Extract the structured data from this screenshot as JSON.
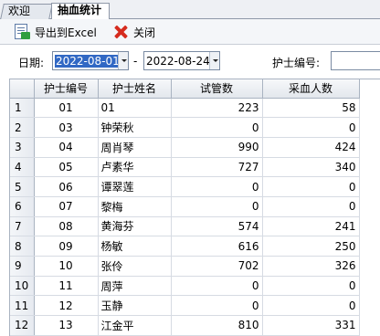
{
  "tabs": [
    {
      "label": "欢迎"
    },
    {
      "label": "抽血统计"
    }
  ],
  "toolbar": {
    "export_label": "导出到Excel",
    "close_label": "关闭"
  },
  "filter": {
    "date_label": "日期:",
    "start_date": "2022-08-01",
    "dash": "-",
    "end_date": "2022-08-24",
    "nurse_id_label": "护士编号:",
    "nurse_id_value": ""
  },
  "grid": {
    "columns": [
      "",
      "护士编号",
      "护士姓名",
      "试管数",
      "采血人数"
    ],
    "rows": [
      {
        "n": "1",
        "id": "01",
        "name": "01",
        "tubes": "223",
        "people": "58"
      },
      {
        "n": "2",
        "id": "03",
        "name": "钟荣秋",
        "tubes": "0",
        "people": "0"
      },
      {
        "n": "3",
        "id": "04",
        "name": "周肖琴",
        "tubes": "990",
        "people": "424"
      },
      {
        "n": "4",
        "id": "05",
        "name": "卢素华",
        "tubes": "727",
        "people": "340"
      },
      {
        "n": "5",
        "id": "06",
        "name": "谭翠莲",
        "tubes": "0",
        "people": "0"
      },
      {
        "n": "6",
        "id": "07",
        "name": "黎梅",
        "tubes": "0",
        "people": "0"
      },
      {
        "n": "7",
        "id": "08",
        "name": "黄海芬",
        "tubes": "574",
        "people": "241"
      },
      {
        "n": "8",
        "id": "09",
        "name": "杨敏",
        "tubes": "616",
        "people": "250"
      },
      {
        "n": "9",
        "id": "10",
        "name": "张伶",
        "tubes": "702",
        "people": "326"
      },
      {
        "n": "10",
        "id": "11",
        "name": "周萍",
        "tubes": "0",
        "people": "0"
      },
      {
        "n": "11",
        "id": "12",
        "name": "玉静",
        "tubes": "0",
        "people": "0"
      },
      {
        "n": "12",
        "id": "13",
        "name": "江金平",
        "tubes": "810",
        "people": "331"
      }
    ]
  }
}
